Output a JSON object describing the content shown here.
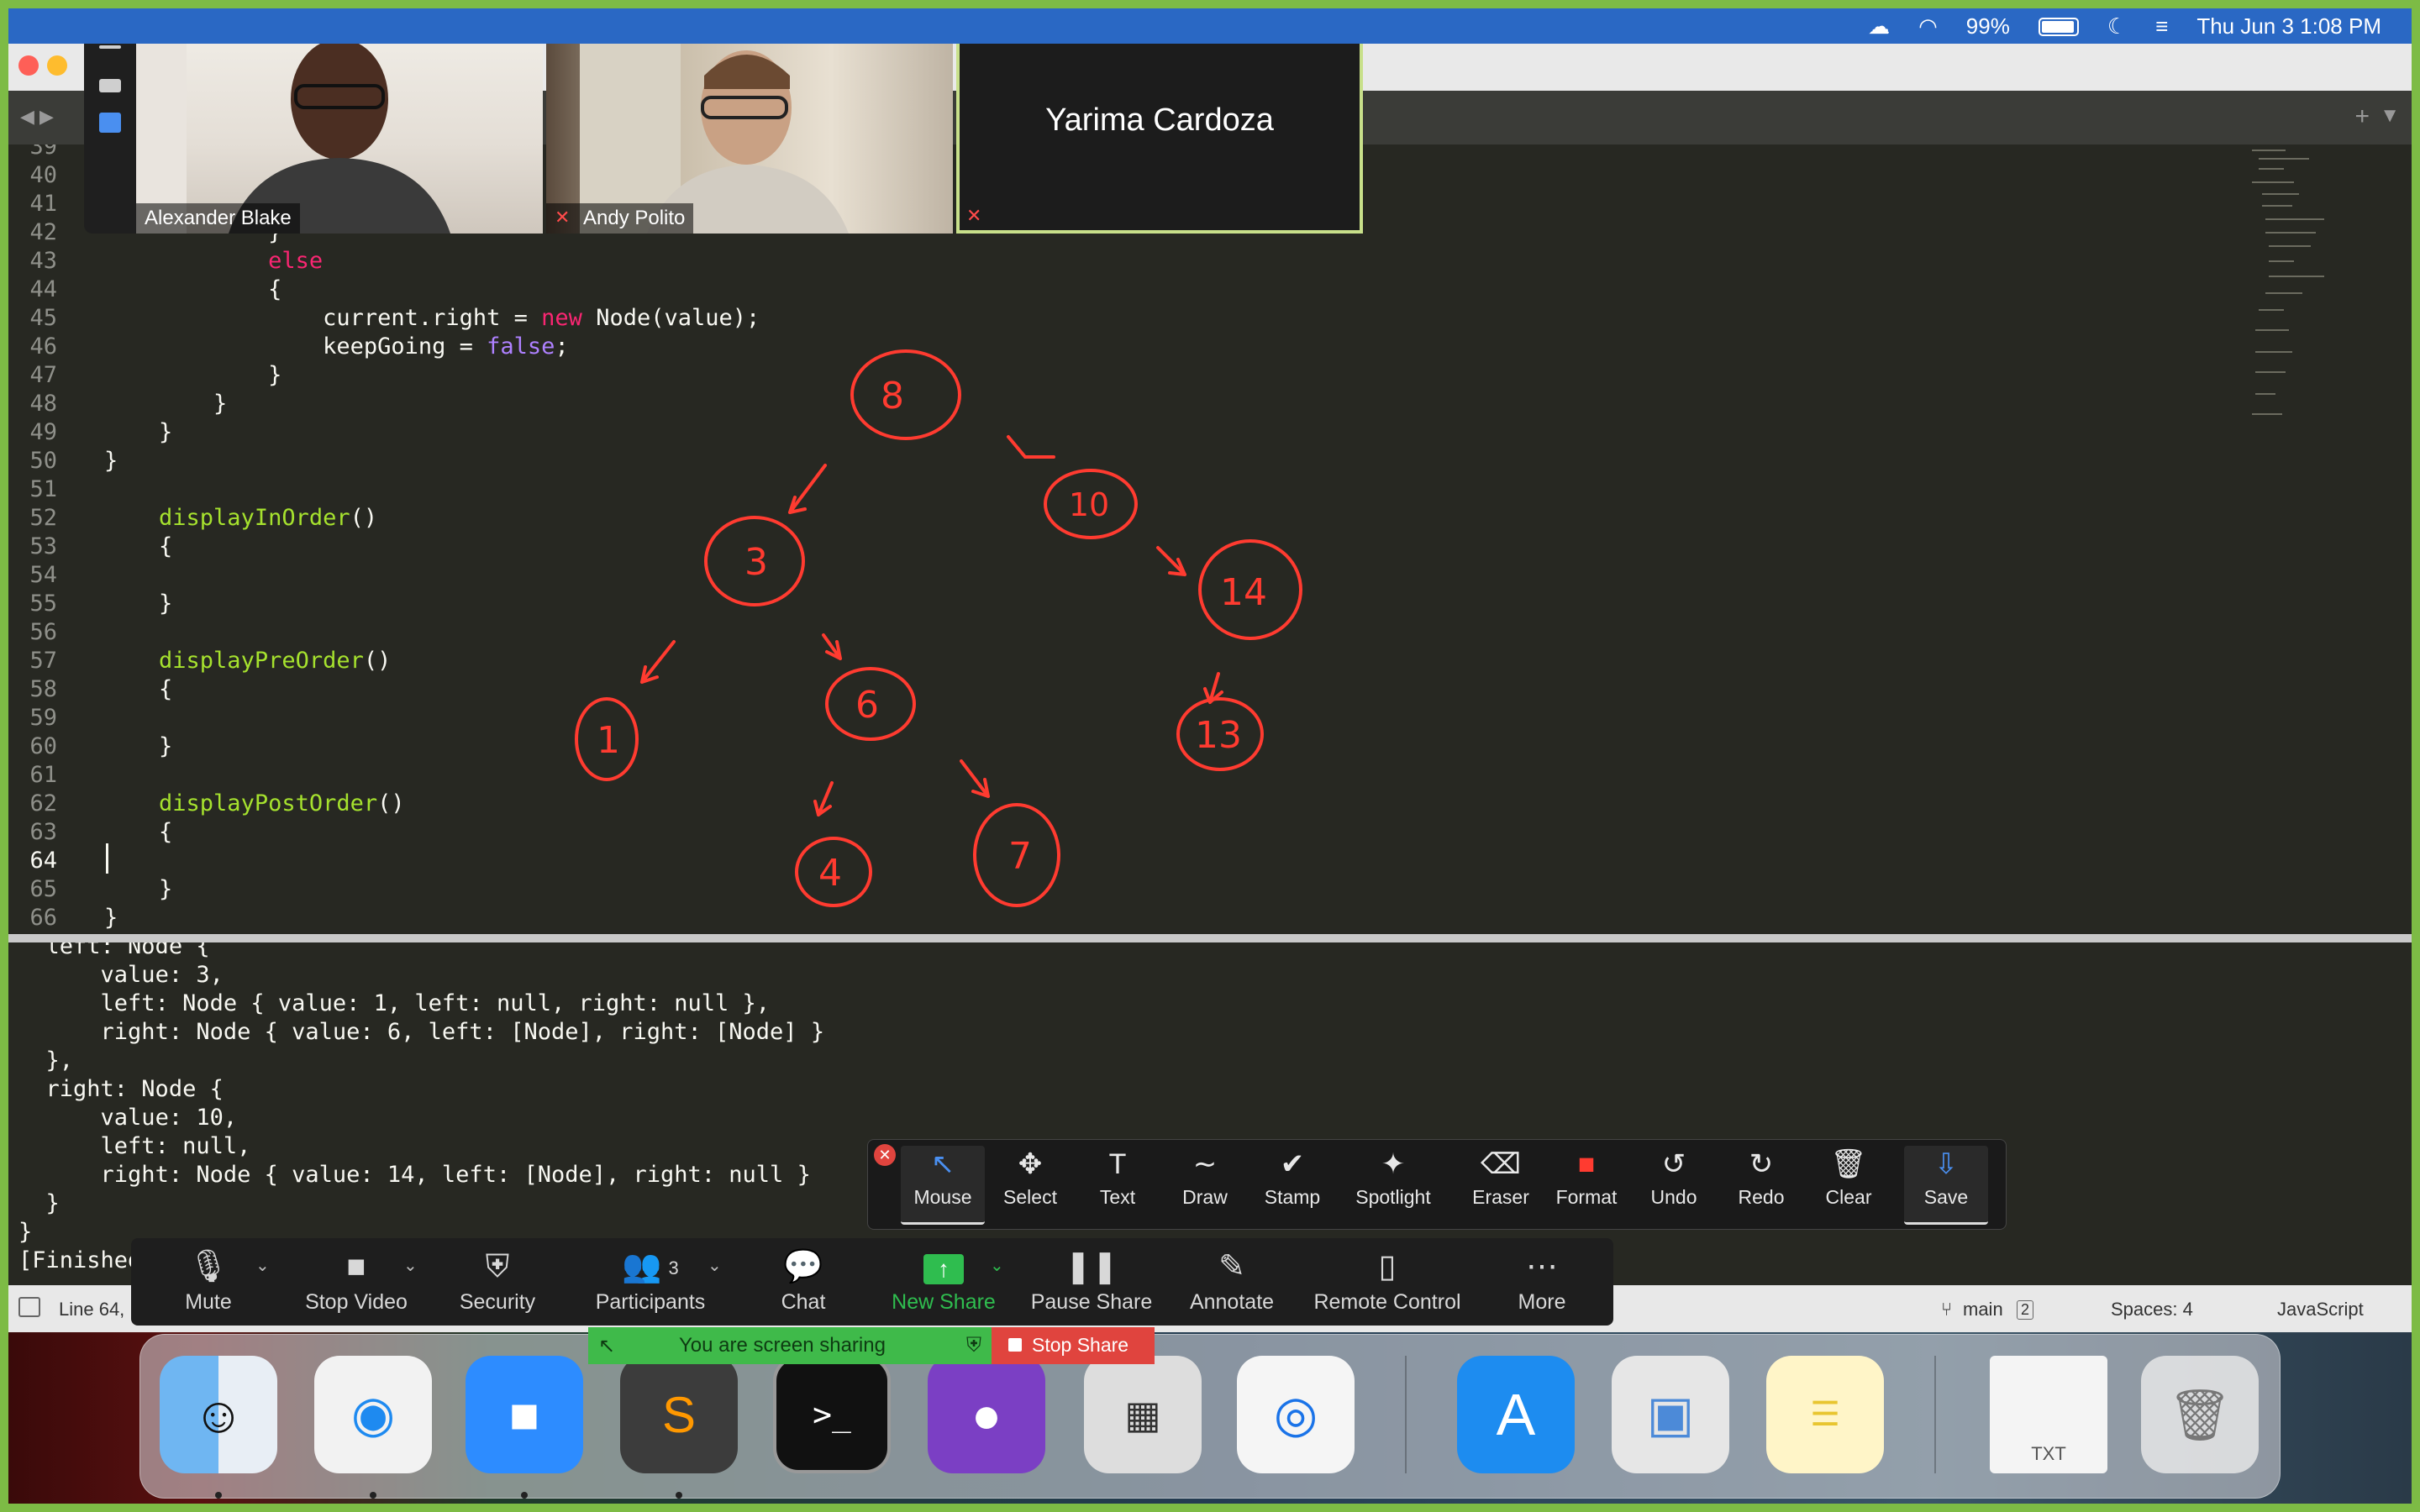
{
  "menubar": {
    "battery_percent": "99%",
    "datetime": "Thu Jun 3  1:08 PM"
  },
  "zoom_videos": {
    "participant1": "Alexander Blake",
    "participant2": "Andy Polito",
    "participant3": "Yarima Cardoza"
  },
  "editor": {
    "lines": [
      {
        "n": "39",
        "text": ""
      },
      {
        "n": "40",
        "text": ""
      },
      {
        "n": "41",
        "text": ""
      },
      {
        "n": "42",
        "text": "            }"
      },
      {
        "n": "43",
        "kw": "            else",
        "text": ""
      },
      {
        "n": "44",
        "text": "            {"
      },
      {
        "n": "45",
        "pre": "                current.right = ",
        "kw2": "new",
        "post": " Node(value);"
      },
      {
        "n": "46",
        "pre": "                keepGoing = ",
        "bool": "false",
        "post": ";"
      },
      {
        "n": "47",
        "text": "            }"
      },
      {
        "n": "48",
        "text": "        }"
      },
      {
        "n": "49",
        "text": "    }"
      },
      {
        "n": "50",
        "text": "}"
      },
      {
        "n": "51",
        "text": ""
      },
      {
        "n": "52",
        "fn": "displayInOrder",
        "text": "()"
      },
      {
        "n": "53",
        "text": "{"
      },
      {
        "n": "54",
        "text": ""
      },
      {
        "n": "55",
        "text": "}"
      },
      {
        "n": "56",
        "text": ""
      },
      {
        "n": "57",
        "fn": "displayPreOrder",
        "text": "()"
      },
      {
        "n": "58",
        "text": "{"
      },
      {
        "n": "59",
        "text": ""
      },
      {
        "n": "60",
        "text": "}"
      },
      {
        "n": "61",
        "text": ""
      },
      {
        "n": "62",
        "fn": "displayPostOrder",
        "text": "()"
      },
      {
        "n": "63",
        "text": "{"
      },
      {
        "n": "64",
        "text": ""
      },
      {
        "n": "65",
        "text": "}"
      },
      {
        "n": "66",
        "text": "}"
      }
    ],
    "drawing_numbers": [
      "8",
      "10",
      "3",
      "14",
      "1",
      "6",
      "13",
      "4",
      "7"
    ]
  },
  "console": {
    "lines": [
      "left: Node {",
      "  value: 3,",
      "  left: Node { value: 1, left: null, right: null },",
      "  right: Node { value: 6, left: [Node], right: [Node] }",
      "},",
      "right: Node {",
      "  value: 10,",
      "  left: null,",
      "  right: Node { value: 14, left: [Node], right: null }",
      "}",
      "}",
      "[Finished"
    ]
  },
  "statusbar": {
    "position": "Line 64,",
    "branch": "main",
    "branch_badge": "2",
    "spaces": "Spaces: 4",
    "syntax": "JavaScript"
  },
  "annotate_toolbar": {
    "tools": [
      "Mouse",
      "Select",
      "Text",
      "Draw",
      "Stamp",
      "Spotlight",
      "Eraser",
      "Format",
      "Undo",
      "Redo",
      "Clear",
      "Save"
    ]
  },
  "zoom_controls": {
    "mute": "Mute",
    "stop_video": "Stop Video",
    "security": "Security",
    "participants": "Participants",
    "participants_count": "3",
    "chat": "Chat",
    "new_share": "New Share",
    "pause_share": "Pause Share",
    "annotate": "Annotate",
    "remote_control": "Remote Control",
    "more": "More",
    "sharing_status": "You are screen sharing",
    "stop_share": "Stop Share"
  },
  "dock": {
    "txt_label": "TXT"
  },
  "colors": {
    "editor_bg": "#272822",
    "keyword": "#f92672",
    "function": "#a6e22e",
    "boolean": "#ae81ff",
    "annotation_red": "#ff3b30",
    "share_green": "#3fba4a"
  }
}
